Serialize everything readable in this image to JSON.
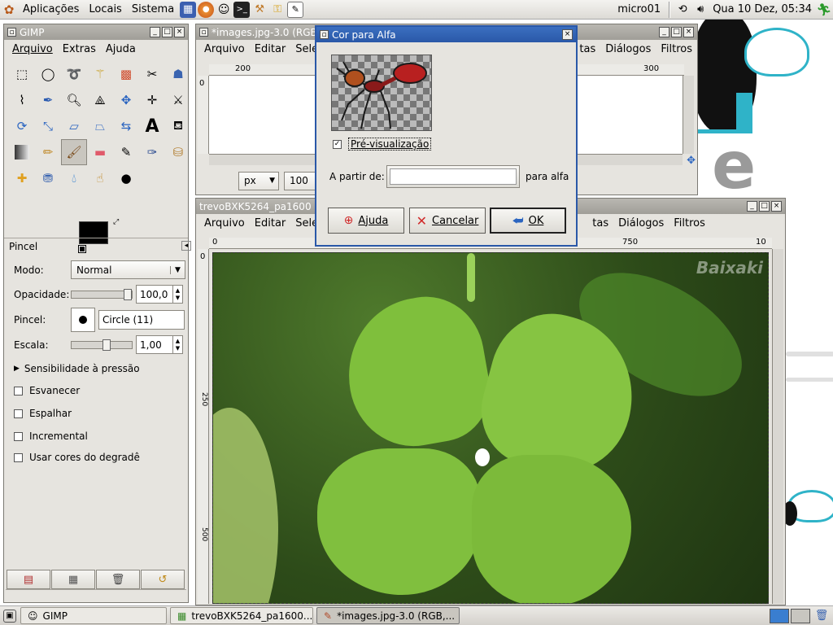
{
  "top_panel": {
    "menus": [
      "Aplicações",
      "Locais",
      "Sistema"
    ],
    "user": "micro01",
    "clock": "Qua 10 Dez, 05:34"
  },
  "toolbox": {
    "title": "GIMP",
    "menu": [
      "Arquivo",
      "Extras",
      "Ajuda"
    ],
    "options_title": "Pincel",
    "mode_label": "Modo:",
    "mode_value": "Normal",
    "opacity_label": "Opacidade:",
    "opacity_value": "100,0",
    "opacity_fraction": 1.0,
    "brush_label": "Pincel:",
    "brush_value": "Circle (11)",
    "scale_label": "Escala:",
    "scale_value": "1,00",
    "pressure_label": "Sensibilidade à pressão",
    "checks": [
      {
        "label": "Esvanecer",
        "checked": false
      },
      {
        "label": "Espalhar",
        "checked": false
      },
      {
        "label": "Incremental",
        "checked": false
      },
      {
        "label": "Usar cores do degradê",
        "checked": false
      }
    ]
  },
  "image1": {
    "title": "*images.jpg-3.0 (RGB",
    "menu": [
      "Arquivo",
      "Editar",
      "Seleç",
      "tas",
      "Diálogos",
      "Filtros"
    ],
    "ruler_labels": [
      "200",
      "300"
    ],
    "vruler_label": "0",
    "unit": "px",
    "zoom": "100"
  },
  "image2": {
    "title": "trevoBXK5264_pa1600",
    "menu": [
      "Arquivo",
      "Editar",
      "Seleç",
      "tas",
      "Diálogos",
      "Filtros"
    ],
    "ruler_labels": [
      "0",
      "750",
      "10"
    ],
    "vruler_labels": [
      "0",
      "250",
      "500"
    ],
    "watermark": "Baixaki"
  },
  "dialog": {
    "title": "Cor para Alfa",
    "preview_label": "Pré-visualização",
    "preview_checked": true,
    "from_label": "A partir de:",
    "to_label": "para alfa",
    "help_label": "Ajuda",
    "cancel_label": "Cancelar",
    "ok_label": "OK"
  },
  "taskbar": {
    "tasks": [
      "GIMP",
      "trevoBXK5264_pa1600...",
      "*images.jpg-3.0 (RGB,..."
    ]
  },
  "colors": {
    "titlebar_active": "#2a58a8",
    "leaf": "#7fbf3c",
    "accent_cyan": "#2fb3c8"
  }
}
